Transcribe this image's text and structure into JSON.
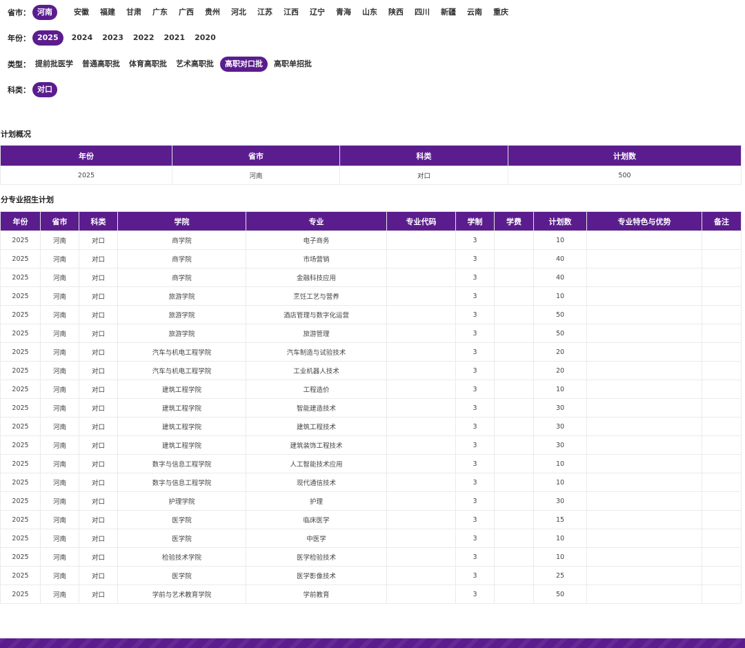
{
  "filters": {
    "province": {
      "label": "省市：",
      "options": [
        "河南",
        "安徽",
        "福建",
        "甘肃",
        "广东",
        "广西",
        "贵州",
        "河北",
        "江苏",
        "江西",
        "辽宁",
        "青海",
        "山东",
        "陕西",
        "四川",
        "新疆",
        "云南",
        "重庆"
      ],
      "selected": "河南"
    },
    "year": {
      "label": "年份：",
      "options": [
        "2025",
        "2024",
        "2023",
        "2022",
        "2021",
        "2020"
      ],
      "selected": "2025"
    },
    "type": {
      "label": "类型：",
      "options": [
        "提前批医学",
        "普通高职批",
        "体育高职批",
        "艺术高职批",
        "高职对口批",
        "高职单招批"
      ],
      "selected": "高职对口批"
    },
    "subject": {
      "label": "科类：",
      "options": [
        "对口"
      ],
      "selected": "对口"
    }
  },
  "plan_overview": {
    "title": "计划概况",
    "headers": [
      "年份",
      "省市",
      "科类",
      "计划数"
    ],
    "rows": [
      [
        "2025",
        "河南",
        "对口",
        "500"
      ]
    ]
  },
  "major_plan": {
    "title": "分专业招生计划",
    "headers": [
      "年份",
      "省市",
      "科类",
      "学院",
      "专业",
      "专业代码",
      "学制",
      "学费",
      "计划数",
      "专业特色与优势",
      "备注"
    ],
    "rows": [
      [
        "2025",
        "河南",
        "对口",
        "商学院",
        "电子商务",
        "",
        "3",
        "",
        "10",
        "",
        ""
      ],
      [
        "2025",
        "河南",
        "对口",
        "商学院",
        "市场营销",
        "",
        "3",
        "",
        "40",
        "",
        ""
      ],
      [
        "2025",
        "河南",
        "对口",
        "商学院",
        "金融科技应用",
        "",
        "3",
        "",
        "40",
        "",
        ""
      ],
      [
        "2025",
        "河南",
        "对口",
        "旅游学院",
        "烹饪工艺与营养",
        "",
        "3",
        "",
        "10",
        "",
        ""
      ],
      [
        "2025",
        "河南",
        "对口",
        "旅游学院",
        "酒店管理与数字化运营",
        "",
        "3",
        "",
        "50",
        "",
        ""
      ],
      [
        "2025",
        "河南",
        "对口",
        "旅游学院",
        "旅游管理",
        "",
        "3",
        "",
        "50",
        "",
        ""
      ],
      [
        "2025",
        "河南",
        "对口",
        "汽车与机电工程学院",
        "汽车制造与试验技术",
        "",
        "3",
        "",
        "20",
        "",
        ""
      ],
      [
        "2025",
        "河南",
        "对口",
        "汽车与机电工程学院",
        "工业机器人技术",
        "",
        "3",
        "",
        "20",
        "",
        ""
      ],
      [
        "2025",
        "河南",
        "对口",
        "建筑工程学院",
        "工程造价",
        "",
        "3",
        "",
        "10",
        "",
        ""
      ],
      [
        "2025",
        "河南",
        "对口",
        "建筑工程学院",
        "智能建造技术",
        "",
        "3",
        "",
        "30",
        "",
        ""
      ],
      [
        "2025",
        "河南",
        "对口",
        "建筑工程学院",
        "建筑工程技术",
        "",
        "3",
        "",
        "30",
        "",
        ""
      ],
      [
        "2025",
        "河南",
        "对口",
        "建筑工程学院",
        "建筑装饰工程技术",
        "",
        "3",
        "",
        "30",
        "",
        ""
      ],
      [
        "2025",
        "河南",
        "对口",
        "数字与信息工程学院",
        "人工智能技术应用",
        "",
        "3",
        "",
        "10",
        "",
        ""
      ],
      [
        "2025",
        "河南",
        "对口",
        "数字与信息工程学院",
        "现代通信技术",
        "",
        "3",
        "",
        "10",
        "",
        ""
      ],
      [
        "2025",
        "河南",
        "对口",
        "护理学院",
        "护理",
        "",
        "3",
        "",
        "30",
        "",
        ""
      ],
      [
        "2025",
        "河南",
        "对口",
        "医学院",
        "临床医学",
        "",
        "3",
        "",
        "15",
        "",
        ""
      ],
      [
        "2025",
        "河南",
        "对口",
        "医学院",
        "中医学",
        "",
        "3",
        "",
        "10",
        "",
        ""
      ],
      [
        "2025",
        "河南",
        "对口",
        "检验技术学院",
        "医学检验技术",
        "",
        "3",
        "",
        "10",
        "",
        ""
      ],
      [
        "2025",
        "河南",
        "对口",
        "医学院",
        "医学影像技术",
        "",
        "3",
        "",
        "25",
        "",
        ""
      ],
      [
        "2025",
        "河南",
        "对口",
        "学前与艺术教育学院",
        "学前教育",
        "",
        "3",
        "",
        "50",
        "",
        ""
      ]
    ]
  },
  "theme": {
    "accent": "#5b1d8e"
  }
}
